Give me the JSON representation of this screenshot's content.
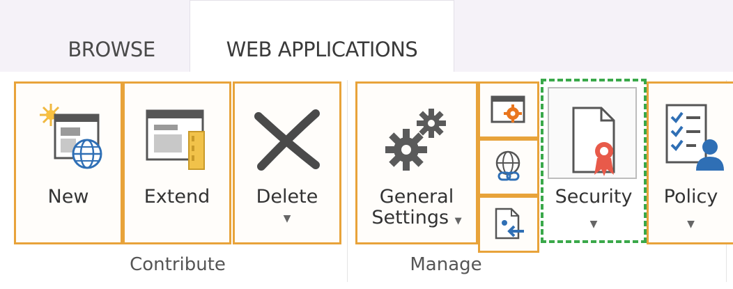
{
  "tabs": [
    {
      "label": "BROWSE"
    },
    {
      "label": "WEB APPLICATIONS"
    }
  ],
  "groups": {
    "contribute": {
      "label": "Contribute"
    },
    "manage": {
      "label": "Manage"
    }
  },
  "buttons": {
    "new": {
      "label": "New"
    },
    "extend": {
      "label": "Extend"
    },
    "delete": {
      "label": "Delete"
    },
    "general_settings": {
      "label_line1": "General",
      "label_line2": "Settings"
    },
    "security": {
      "label": "Security"
    },
    "policy": {
      "label": "Policy"
    }
  },
  "icons": {
    "new": "new-webapp-icon",
    "extend": "extend-webapp-icon",
    "delete": "delete-x-icon",
    "general_settings": "gears-icon",
    "small_1": "window-gear-icon",
    "small_2": "globe-link-icon",
    "small_3": "document-arrow-icon",
    "security": "certificate-document-icon",
    "policy": "checklist-user-icon"
  },
  "colors": {
    "highlight_border": "#e8a33a",
    "security_dashed": "#3aa84a",
    "tab_strip": "#f5f2f8"
  }
}
